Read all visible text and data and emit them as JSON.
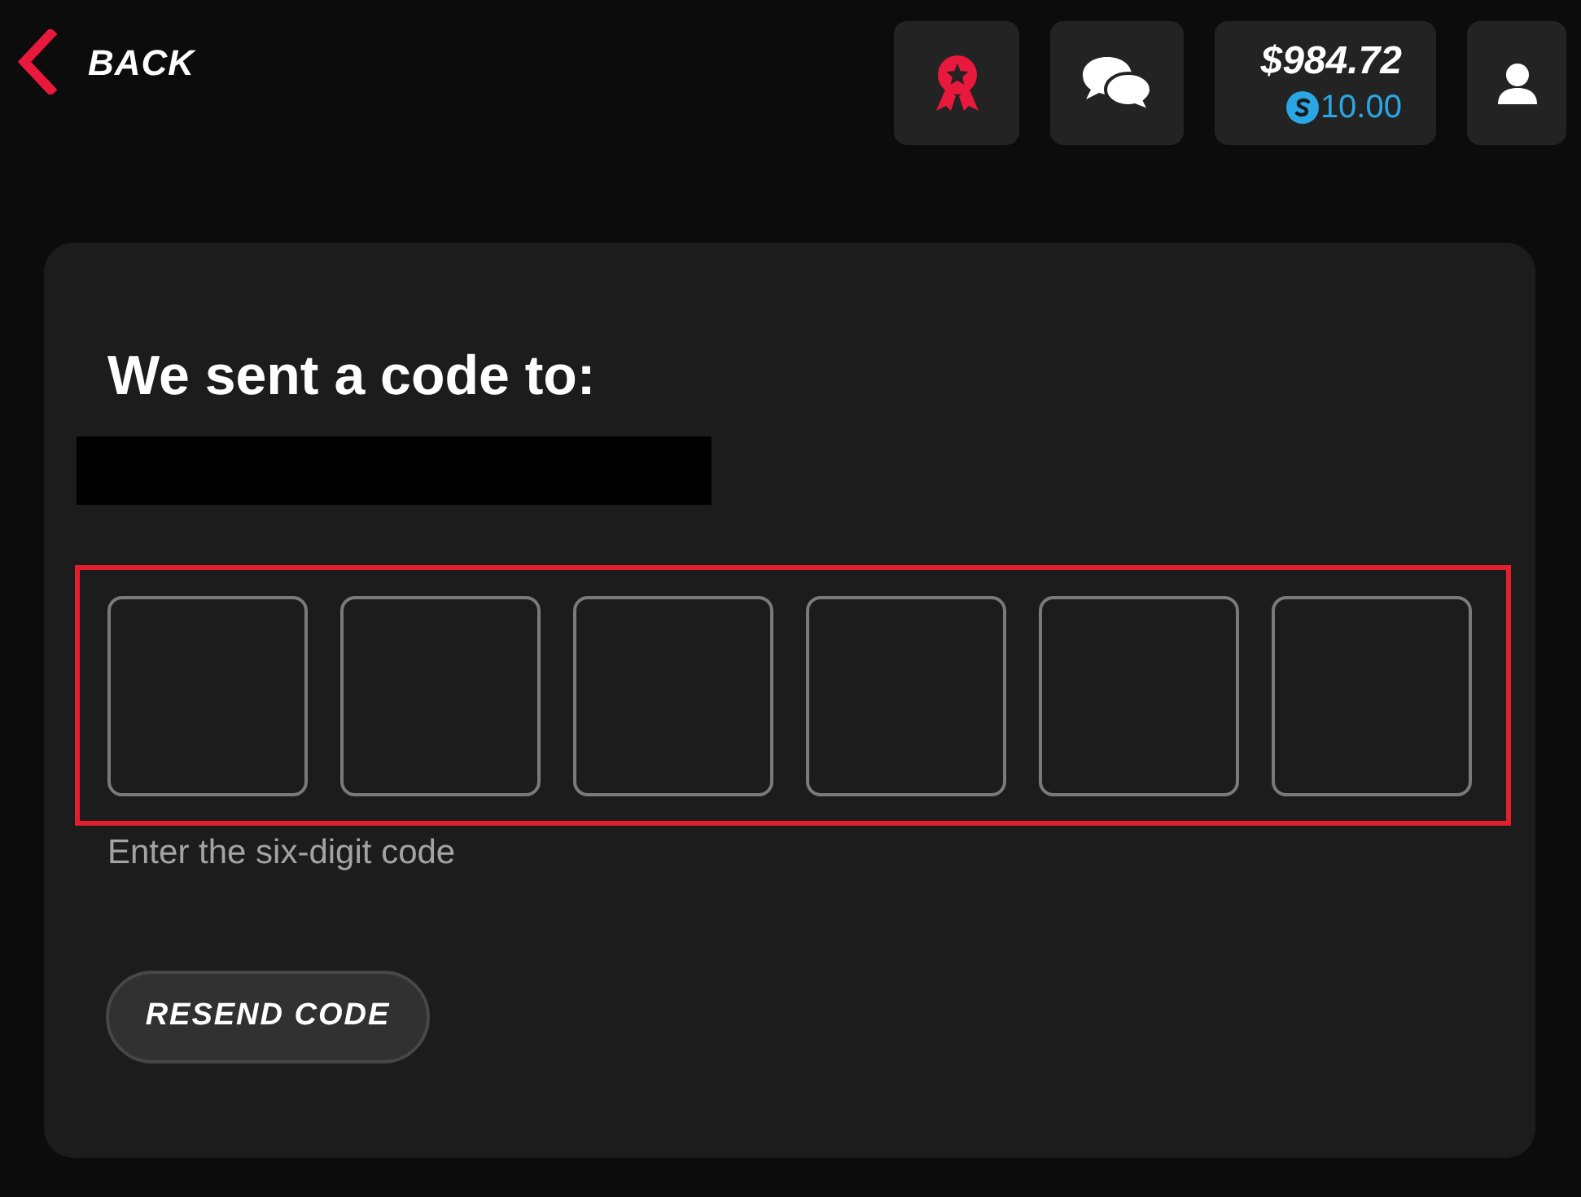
{
  "header": {
    "back_label": "BACK",
    "balance": {
      "amount": "$984.72",
      "bonus": "10.00"
    }
  },
  "verification": {
    "title": "We sent a code to:",
    "recipient_redacted": true,
    "code_highlighted": true,
    "code_boxes": [
      {
        "filled": false
      },
      {
        "filled": false
      },
      {
        "filled": false
      },
      {
        "filled": false
      },
      {
        "filled": false
      },
      {
        "filled": false
      }
    ],
    "hint": "Enter the six-digit code",
    "resend_button": "RESEND CODE"
  }
}
